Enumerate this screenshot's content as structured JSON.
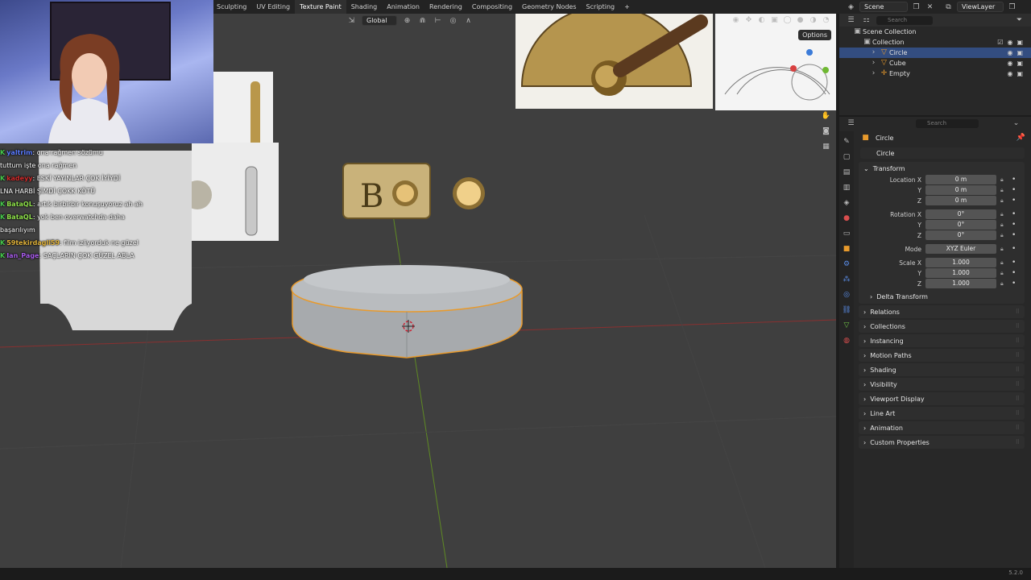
{
  "workspaces": [
    "Sculpting",
    "UV Editing",
    "Texture Paint",
    "Shading",
    "Animation",
    "Rendering",
    "Compositing",
    "Geometry Nodes",
    "Scripting",
    "+"
  ],
  "scene": {
    "label": "Scene",
    "viewlayer": "ViewLayer"
  },
  "viewport": {
    "orientation": "Global",
    "options": "Options"
  },
  "chat": [
    {
      "user": "yaltrim",
      "color": "#5a7bff",
      "msg": ": ona rağmen sözümu"
    },
    {
      "user": "",
      "color": "#ffffff",
      "msg": "tuttum işte ona rağmen"
    },
    {
      "user": "kadeyy",
      "color": "#d12b2b",
      "msg": ": ESKİ YAYINLAR ÇOK İYİYDİ"
    },
    {
      "user": "",
      "color": "#ffffff",
      "msg": "LNA HARBİ ŞİMDİ ÇOKK KÖTÜ"
    },
    {
      "user": "BataQL",
      "color": "#8ee04a",
      "msg": ": artık birbirbir konuşuyoruz ah ah"
    },
    {
      "user": "BataQL",
      "color": "#8ee04a",
      "msg": ": yok ben overwatchda daha"
    },
    {
      "user": "",
      "color": "#ffffff",
      "msg": "başarılıyım"
    },
    {
      "user": "59tekirdagli59",
      "color": "#e0b23a",
      "msg": ": film izliyorduk ne güzel"
    },
    {
      "user": "Ian_Page",
      "color": "#a65ce8",
      "msg": ": SAÇLARIN ÇOK GÜZEL ABLA"
    }
  ],
  "outliner": {
    "search": "Search",
    "root": "Scene Collection",
    "collection": "Collection",
    "items": [
      {
        "name": "Circle",
        "selected": true
      },
      {
        "name": "Cube",
        "selected": false
      },
      {
        "name": "Empty",
        "selected": false
      }
    ]
  },
  "properties": {
    "search": "Search",
    "object_title": "Circle",
    "object_name": "Circle",
    "transform": {
      "title": "Transform",
      "location": {
        "label": "Location X",
        "x": "0 m",
        "y": "0 m",
        "z": "0 m"
      },
      "rotation": {
        "label": "Rotation X",
        "x": "0°",
        "y": "0°",
        "z": "0°"
      },
      "mode": {
        "label": "Mode",
        "value": "XYZ Euler"
      },
      "scale": {
        "label": "Scale X",
        "x": "1.000",
        "y": "1.000",
        "z": "1.000"
      },
      "y_label": "Y",
      "z_label": "Z",
      "delta": "Delta Transform"
    },
    "panels": [
      "Relations",
      "Collections",
      "Instancing",
      "Motion Paths",
      "Shading",
      "Visibility",
      "Viewport Display",
      "Line Art",
      "Animation",
      "Custom Properties"
    ]
  },
  "status": {
    "version": "5.2.0"
  }
}
